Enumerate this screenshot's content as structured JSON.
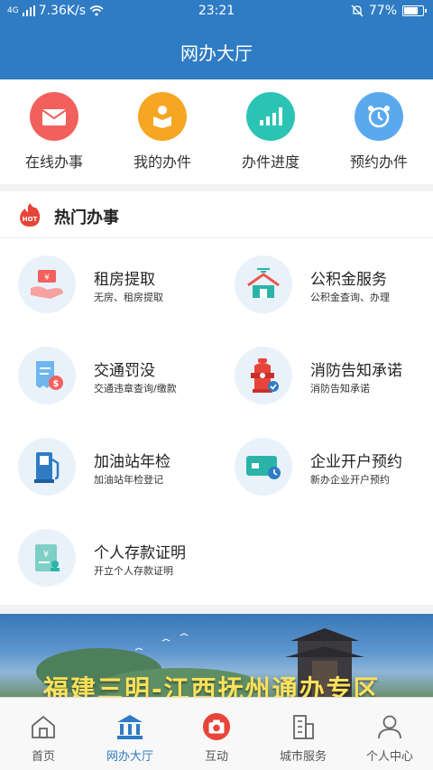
{
  "status_bar": {
    "network": "4G",
    "speed": "7.36K/s",
    "time": "23:21",
    "battery": "77%",
    "battery_level": 0.77
  },
  "header": {
    "title": "网办大厅"
  },
  "quick_actions": [
    {
      "label": "在线办事",
      "icon": "envelope-icon",
      "color": "#f2605e"
    },
    {
      "label": "我的办件",
      "icon": "reading-person-icon",
      "color": "#f5a623"
    },
    {
      "label": "办件进度",
      "icon": "bar-progress-icon",
      "color": "#2bc4b4"
    },
    {
      "label": "预约办件",
      "icon": "alarm-clock-icon",
      "color": "#5aa9ef"
    }
  ],
  "hot_section": {
    "badge": "HOT",
    "title": "热门办事"
  },
  "services": [
    {
      "name": "租房提取",
      "sub": "无房、租房提取",
      "icon": "rent-withdraw-icon"
    },
    {
      "name": "公积金服务",
      "sub": "公积金查询、办理",
      "icon": "house-fund-icon"
    },
    {
      "name": "交通罚没",
      "sub": "交通违章查询/缴款",
      "icon": "traffic-fine-icon"
    },
    {
      "name": "消防告知承诺",
      "sub": "消防告知承诺",
      "icon": "fire-hydrant-icon"
    },
    {
      "name": "加油站年检",
      "sub": "加油站年检登记",
      "icon": "gas-pump-icon"
    },
    {
      "name": "企业开户预约",
      "sub": "新办企业开户预约",
      "icon": "bank-card-clock-icon"
    },
    {
      "name": "个人存款证明",
      "sub": "开立个人存款证明",
      "icon": "deposit-certificate-icon"
    }
  ],
  "banner": {
    "text": "福建三明-江西抚州通办专区"
  },
  "tabs": [
    {
      "label": "首页",
      "icon": "home-icon",
      "active": false
    },
    {
      "label": "网办大厅",
      "icon": "government-hall-icon",
      "active": true
    },
    {
      "label": "互动",
      "icon": "camera-icon",
      "active": false
    },
    {
      "label": "城市服务",
      "icon": "city-building-icon",
      "active": false
    },
    {
      "label": "个人中心",
      "icon": "person-icon",
      "active": false
    }
  ],
  "colors": {
    "primary": "#2f7cc4",
    "hot": "#e8443a",
    "tab_active": "#2f7cc4"
  }
}
